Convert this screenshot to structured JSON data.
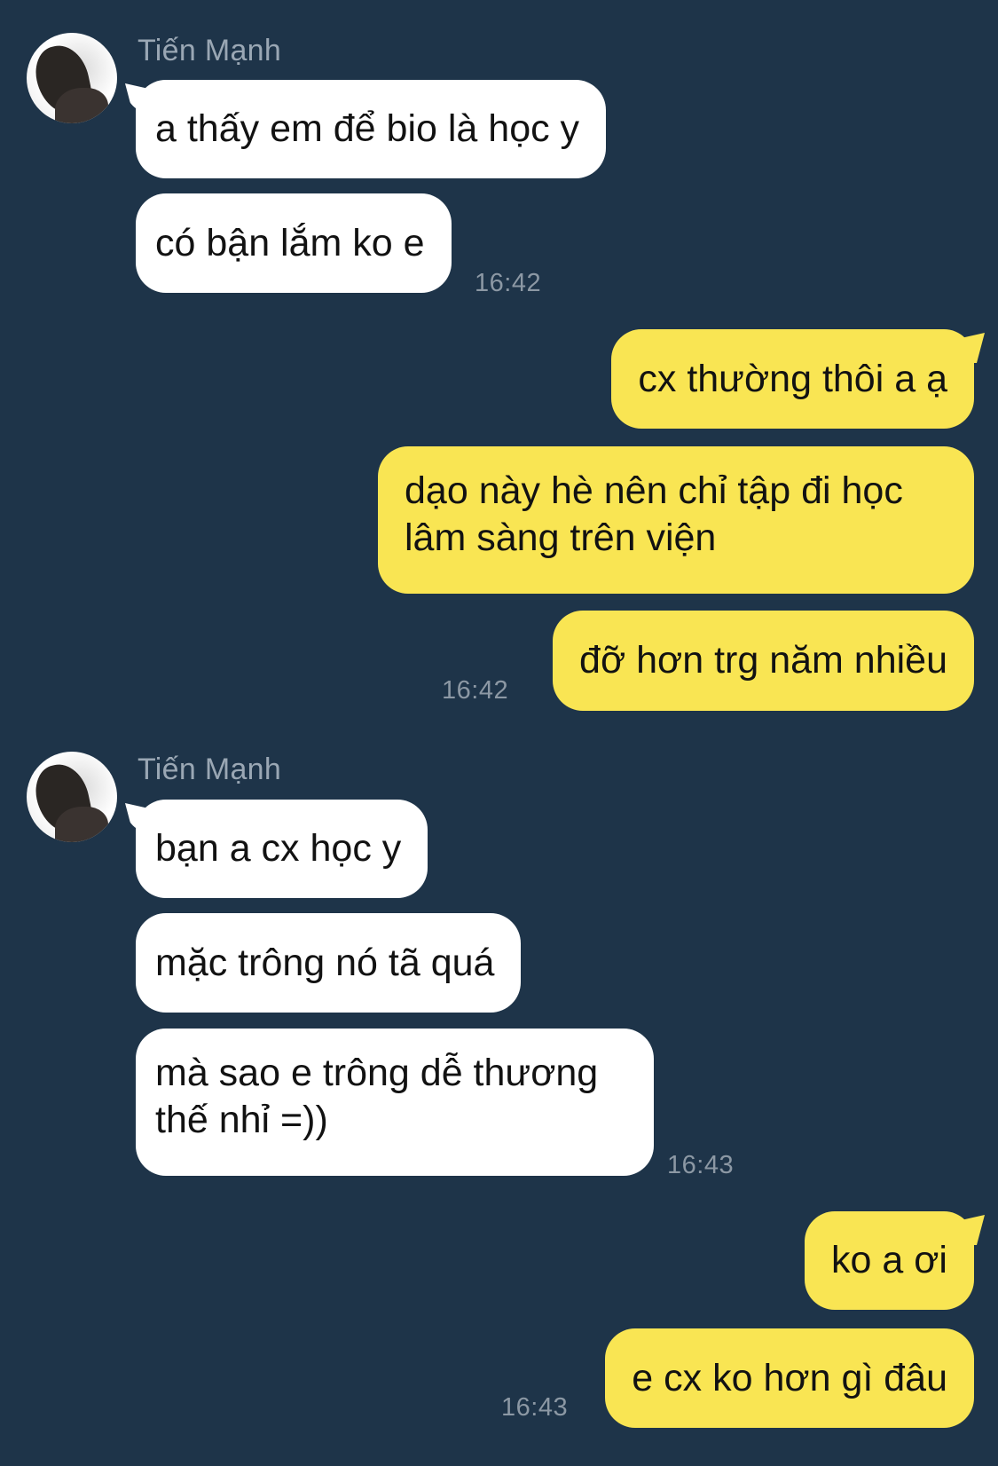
{
  "conversation": {
    "sender_name": "Tiến Mạnh",
    "groups": [
      {
        "direction": "incoming",
        "sender": "Tiến Mạnh",
        "messages": [
          "a thấy em để bio là học y",
          "có bận lắm ko e"
        ],
        "time": "16:42"
      },
      {
        "direction": "outgoing",
        "messages": [
          "cx thường thôi a ạ",
          "dạo này hè nên chỉ tập đi học lâm sàng trên viện",
          "đỡ hơn trg năm nhiều"
        ],
        "time": "16:42"
      },
      {
        "direction": "incoming",
        "sender": "Tiến Mạnh",
        "messages": [
          "bạn a cx học y",
          "mặc trông nó tã quá",
          "mà sao e trông dễ thương thế nhỉ =))"
        ],
        "time": "16:43"
      },
      {
        "direction": "outgoing",
        "messages": [
          "ko a ơi",
          "e cx ko hơn gì đâu"
        ],
        "time": "16:43"
      }
    ]
  },
  "colors": {
    "background": "#1e3449",
    "incoming_bubble": "#ffffff",
    "outgoing_bubble": "#f9e553",
    "timestamp": "#8c98a4",
    "sender_name": "#9aa7b4"
  }
}
